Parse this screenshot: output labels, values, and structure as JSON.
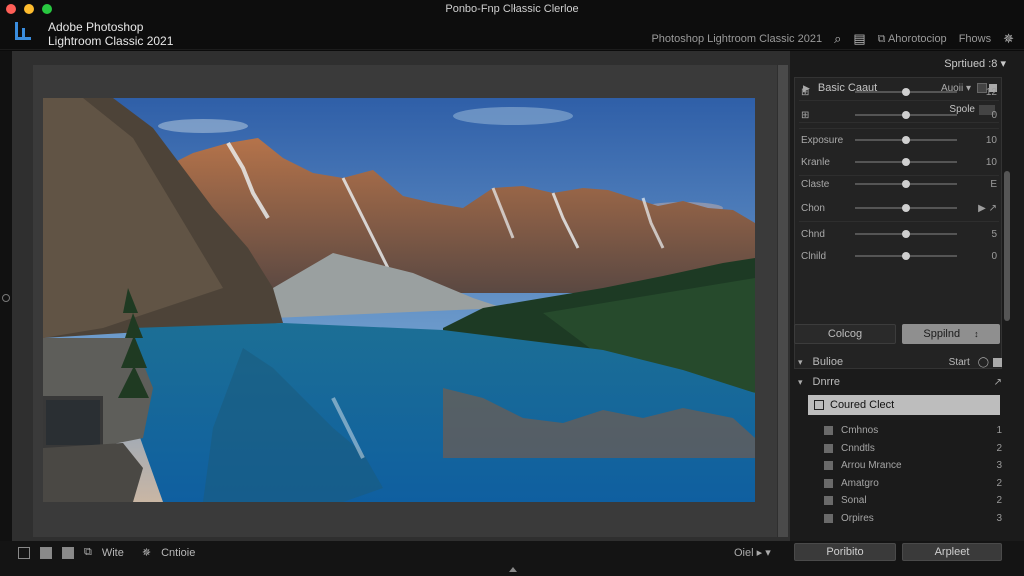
{
  "window": {
    "title": "Ponbo-Fnp Clłassic Clerloe"
  },
  "app": {
    "name_line1": "Adobe Photoshop",
    "name_line2": "Lightroom Classic 2021"
  },
  "topbar": {
    "product_label": "Photoshop Lightroom Classic 2021",
    "menu1": "Ahorotociop",
    "menu2": "Fhows"
  },
  "panel": {
    "header": "Sprtiued :8",
    "section1": {
      "title": "Basic Caaut",
      "mode": "Auoii",
      "subheader": "Spole"
    },
    "sliders": [
      {
        "label": "",
        "value": "12",
        "knob": 0.5
      },
      {
        "label": "",
        "value": "0",
        "knob": 0.5
      },
      {
        "label": "Exposure",
        "value": "10",
        "knob": 0.5
      },
      {
        "label": "Kranle",
        "value": "10",
        "knob": 0.5
      },
      {
        "label": "Claste",
        "value": "E",
        "knob": 0.5
      },
      {
        "label": "Chon",
        "value": "",
        "knob": 0.5
      },
      {
        "label": "Chnd",
        "value": "5",
        "knob": 0.5
      },
      {
        "label": "Clnild",
        "value": "0",
        "knob": 0.5
      }
    ],
    "buttons": {
      "left": "Colcog",
      "right": "Sppilnd"
    },
    "section2": {
      "title": "Bulioe",
      "right": "Start"
    },
    "section3": {
      "title": "Dnrre"
    },
    "collection_header": "Coured Clect",
    "items": [
      {
        "label": "Cmhnos",
        "count": "1"
      },
      {
        "label": "Cnndtls",
        "count": "2"
      },
      {
        "label": "Arrou Mrance",
        "count": "3"
      },
      {
        "label": "Amatgro",
        "count": "2"
      },
      {
        "label": "Sonal",
        "count": "2"
      },
      {
        "label": "Orpires",
        "count": "3"
      }
    ]
  },
  "bottombar": {
    "tool1": "Wite",
    "tool2": "Cntioie",
    "zoom": "Oiel",
    "btn_left": "Poribito",
    "btn_right": "Arpleet"
  }
}
